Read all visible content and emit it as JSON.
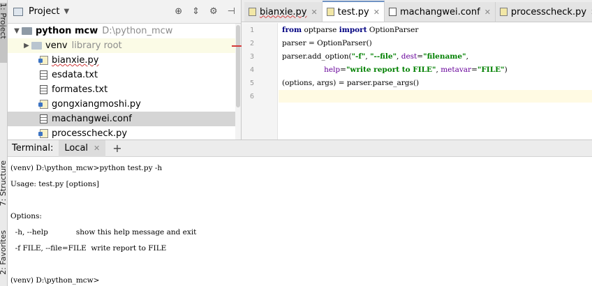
{
  "sidebar_tabs": {
    "project": "1: Project",
    "structure": "7: Structure",
    "favorites": "2: Favorites"
  },
  "project_panel": {
    "title": "Project",
    "root": {
      "name": "python mcw",
      "path": "D:\\python_mcw"
    },
    "venv": {
      "name": "venv",
      "hint": "library root"
    },
    "files": [
      "bianxie.py",
      "esdata.txt",
      "formates.txt",
      "gongxiangmoshi.py",
      "machangwei.conf",
      "processcheck.py"
    ]
  },
  "editor": {
    "tabs": [
      {
        "label": "bianxie.py",
        "active": false
      },
      {
        "label": "test.py",
        "active": true
      },
      {
        "label": "machangwei.conf",
        "active": false
      },
      {
        "label": "processcheck.py",
        "active": false
      }
    ],
    "line_numbers": [
      "1",
      "2",
      "3",
      "4",
      "5",
      "6"
    ],
    "code": {
      "l1_kw1": "from",
      "l1_mod": " optparse ",
      "l1_kw2": "import",
      "l1_name": " OptionParser",
      "l2": "parser = OptionParser()",
      "l3_a": "parser.add_option(",
      "l3_s1": "\"-f\"",
      "l3_b": ", ",
      "l3_s2": "\"--file\"",
      "l3_c": ", ",
      "l3_k": "dest",
      "l3_d": "=",
      "l3_s3": "\"filename\"",
      "l3_e": ",",
      "l4_indent": "                  ",
      "l4_k1": "help",
      "l4_a": "=",
      "l4_s1": "\"write report to FILE\"",
      "l4_b": ", ",
      "l4_k2": "metavar",
      "l4_c": "=",
      "l4_s2": "\"FILE\"",
      "l4_d": ")",
      "l5": "(options, args) = parser.parse_args()"
    }
  },
  "terminal": {
    "label": "Terminal:",
    "tab": "Local",
    "lines": [
      "(venv) D:\\python_mcw>python test.py -h",
      "Usage: test.py [options]",
      "Options:",
      "  -h, --help            show this help message and exit",
      "  -f FILE, --file=FILE  write report to FILE",
      "(venv) D:\\python_mcw>"
    ]
  },
  "colors": {
    "keyword": "#000080",
    "string": "#008000",
    "kwarg": "#660099",
    "active_tab_accent": "#6f93c4"
  }
}
